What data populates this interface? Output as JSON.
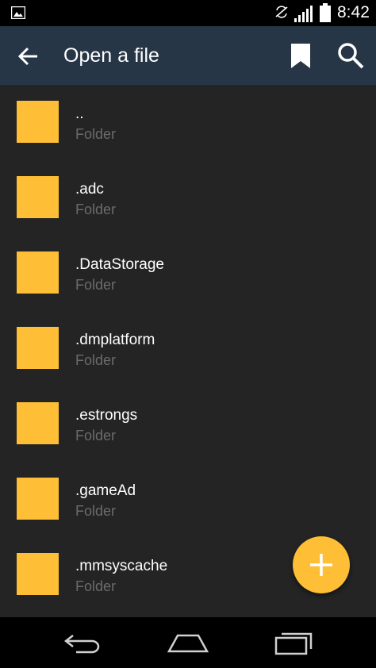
{
  "status_bar": {
    "time": "8:42",
    "icons": [
      "gallery-notification-icon",
      "sync-off-icon",
      "signal-icon",
      "battery-icon"
    ]
  },
  "app_bar": {
    "title": "Open a file",
    "back_icon": "arrow-back-icon",
    "actions": [
      "bookmark-icon",
      "search-icon"
    ],
    "background_color": "#263646"
  },
  "file_list": {
    "items": [
      {
        "name": "..",
        "type": "Folder"
      },
      {
        "name": ".adc",
        "type": "Folder"
      },
      {
        "name": ".DataStorage",
        "type": "Folder"
      },
      {
        "name": ".dmplatform",
        "type": "Folder"
      },
      {
        "name": ".estrongs",
        "type": "Folder"
      },
      {
        "name": ".gameAd",
        "type": "Folder"
      },
      {
        "name": ".mmsyscache",
        "type": "Folder"
      }
    ],
    "folder_color": "#FEBE35"
  },
  "fab": {
    "icon": "plus-icon",
    "color": "#FEBE35"
  },
  "nav_bar": {
    "buttons": [
      "nav-back-icon",
      "nav-home-icon",
      "nav-recents-icon"
    ]
  }
}
